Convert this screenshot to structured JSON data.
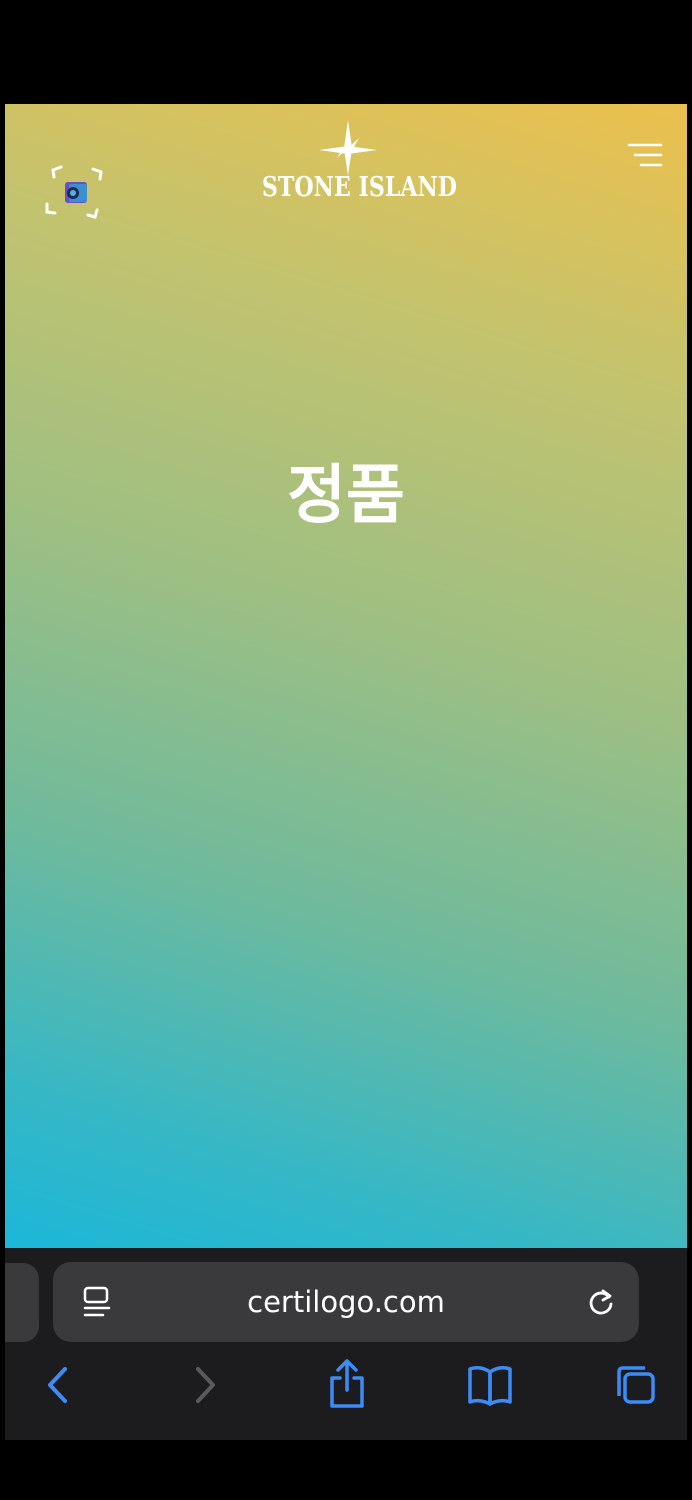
{
  "site": {
    "brand": "STONE ISLAND",
    "headline": "정품",
    "icons": {
      "scan": "scan-camera-icon",
      "menu": "hamburger-menu-icon",
      "logo_mark": "compass-star-icon"
    }
  },
  "browser": {
    "url": "certilogo.com",
    "icons": {
      "reader": "reader-mode-icon",
      "reload": "reload-icon",
      "back": "chevron-left-icon",
      "forward": "chevron-right-icon",
      "share": "share-icon",
      "bookmarks": "book-icon",
      "tabs": "tabs-icon"
    },
    "colors": {
      "accent": "#3d8cf5",
      "disabled": "#5a5a5e",
      "toolbar": "#1c1c1e",
      "field": "#3a3a3c"
    }
  }
}
